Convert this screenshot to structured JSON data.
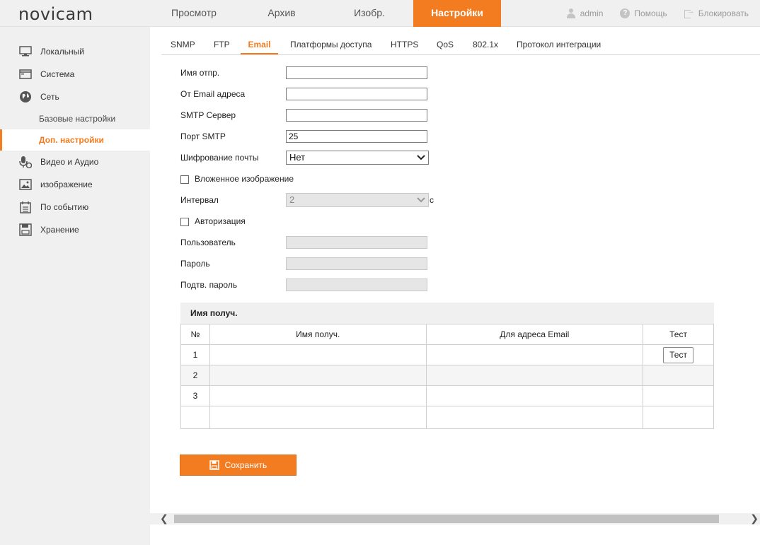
{
  "app": {
    "logo": "novicam"
  },
  "topnav": [
    {
      "label": "Просмотр",
      "active": false
    },
    {
      "label": "Архив",
      "active": false
    },
    {
      "label": "Изобр.",
      "active": false
    },
    {
      "label": "Настройки",
      "active": true
    }
  ],
  "topright": {
    "user": "admin",
    "help": "Помощь",
    "logout": "Блокировать"
  },
  "sidebar": {
    "items": [
      {
        "label": "Локальный",
        "icon": "monitor-icon"
      },
      {
        "label": "Система",
        "icon": "system-icon"
      },
      {
        "label": "Сеть",
        "icon": "globe-icon"
      },
      {
        "label": "Видео и Аудио",
        "icon": "microphone-icon"
      },
      {
        "label": "изображение",
        "icon": "image-icon"
      },
      {
        "label": "По событию",
        "icon": "calendar-icon"
      },
      {
        "label": "Хранение",
        "icon": "floppy-icon"
      }
    ],
    "sub": [
      {
        "label": "Базовые настройки",
        "active": false
      },
      {
        "label": "Доп. настройки",
        "active": true
      }
    ]
  },
  "tabs": [
    {
      "label": "SNMP",
      "active": false
    },
    {
      "label": "FTP",
      "active": false
    },
    {
      "label": "Email",
      "active": true
    },
    {
      "label": "Платформы доступа",
      "active": false
    },
    {
      "label": "HTTPS",
      "active": false
    },
    {
      "label": "QoS",
      "active": false
    },
    {
      "label": "802.1x",
      "active": false
    },
    {
      "label": "Протокол интеграции",
      "active": false
    }
  ],
  "form": {
    "sender_name": {
      "label": "Имя отпр.",
      "value": ""
    },
    "sender_email": {
      "label": "От Email адреса",
      "value": ""
    },
    "smtp_server": {
      "label": "SMTP Сервер",
      "value": ""
    },
    "smtp_port": {
      "label": "Порт SMTP",
      "value": "25"
    },
    "encryption": {
      "label": "Шифрование почты",
      "value": "Нет"
    },
    "attach_image": {
      "label": "Вложенное изображение",
      "checked": false
    },
    "interval": {
      "label": "Интервал",
      "value": "2",
      "unit": "с"
    },
    "auth": {
      "label": "Авторизация",
      "checked": false
    },
    "user": {
      "label": "Пользователь",
      "value": ""
    },
    "password": {
      "label": "Пароль",
      "value": ""
    },
    "confirm_password": {
      "label": "Подтв. пароль",
      "value": ""
    }
  },
  "recipients": {
    "title": "Имя получ.",
    "columns": [
      "№",
      "Имя получ.",
      "Для адреса Email",
      "Тест"
    ],
    "rows": [
      {
        "no": "1",
        "name": "",
        "email": "",
        "test": "Тест"
      },
      {
        "no": "2",
        "name": "",
        "email": "",
        "test": ""
      },
      {
        "no": "3",
        "name": "",
        "email": "",
        "test": ""
      }
    ]
  },
  "save_label": "Сохранить",
  "colors": {
    "accent": "#f47c20",
    "sidebar_bg": "#f0f0f0"
  }
}
